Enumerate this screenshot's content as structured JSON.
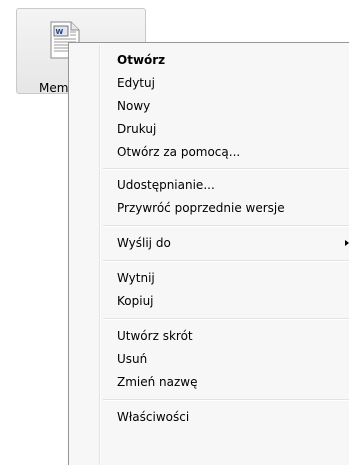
{
  "desktop": {
    "file": {
      "label": "Mem",
      "icon": "word-document-icon"
    }
  },
  "context_menu": {
    "items": [
      {
        "label": "Otwórz",
        "default": true
      },
      {
        "label": "Edytuj"
      },
      {
        "label": "Nowy"
      },
      {
        "label": "Drukuj"
      },
      {
        "label": "Otwórz za pomocą..."
      },
      {
        "label": "Udostępnianie..."
      },
      {
        "label": "Przywróć poprzednie wersje"
      },
      {
        "label": "Wyślij do",
        "submenu_icon": "chevron-right-icon"
      },
      {
        "label": "Wytnij"
      },
      {
        "label": "Kopiuj"
      },
      {
        "label": "Utwórz skrót"
      },
      {
        "label": "Usuń"
      },
      {
        "label": "Zmień nazwę"
      },
      {
        "label": "Właściwości"
      }
    ]
  }
}
